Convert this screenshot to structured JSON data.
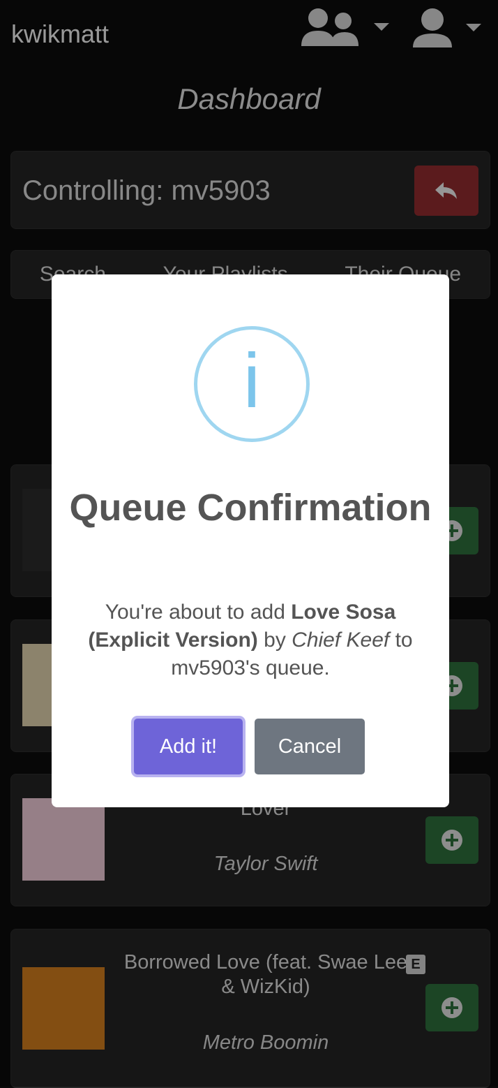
{
  "app": {
    "brand": "kwikmatt",
    "page_title": "Dashboard"
  },
  "control": {
    "label": "Controlling: mv5903"
  },
  "tabs": [
    "Search",
    "Your Playlists",
    "Their Queue"
  ],
  "songs": [
    {
      "name": "Lover",
      "artist": "Taylor Swift",
      "explicit": false
    },
    {
      "name": "Borrowed Love (feat. Swae Lee & WizKid)",
      "artist": "Metro Boomin",
      "explicit": true,
      "explicit_badge": "E"
    }
  ],
  "modal": {
    "title": "Queue Confirmation",
    "text_prefix": "You're about to add ",
    "song": "Love Sosa (Explicit Version)",
    "text_mid": " by ",
    "artist": "Chief Keef",
    "text_suffix": " to mv5903's queue.",
    "confirm_label": "Add it!",
    "cancel_label": "Cancel"
  },
  "colors": {
    "danger": "#8c2a2d",
    "success": "#2c6a3a",
    "primary": "#6e64d8",
    "secondary": "#6e7680",
    "info": "#7cc5eb"
  }
}
